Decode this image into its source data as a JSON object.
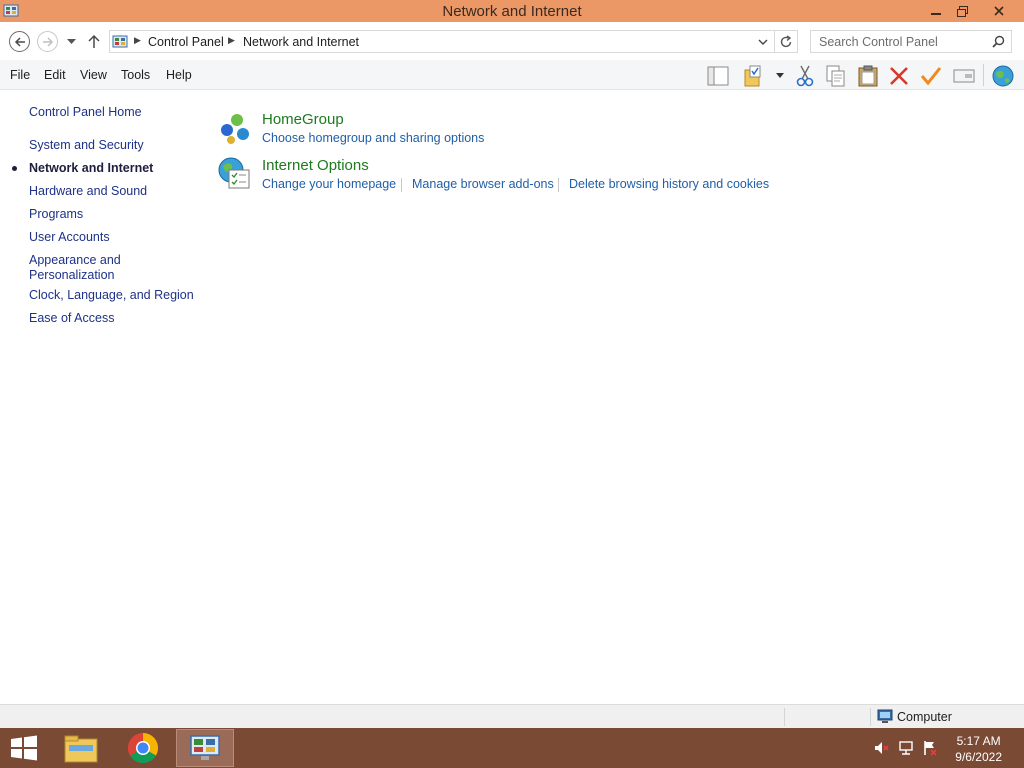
{
  "window": {
    "title": "Network and Internet"
  },
  "address_bar": {
    "breadcrumbs": [
      "Control Panel",
      "Network and Internet"
    ]
  },
  "search": {
    "placeholder": "Search Control Panel"
  },
  "menu": {
    "items": [
      "File",
      "Edit",
      "View",
      "Tools",
      "Help"
    ]
  },
  "toolbar": {
    "icons": [
      "layout-icon",
      "folder-options-icon",
      "cut-icon",
      "copy-icon",
      "paste-icon",
      "delete-icon",
      "checkmark-icon",
      "properties-icon",
      "globe-icon"
    ]
  },
  "sidebar": {
    "home": "Control Panel Home",
    "items": [
      "System and Security",
      "Network and Internet",
      "Hardware and Sound",
      "Programs",
      "User Accounts",
      "Appearance and Personalization",
      "Clock, Language, and Region",
      "Ease of Access"
    ],
    "current_index": 1
  },
  "categories": [
    {
      "title": "HomeGroup",
      "icon": "homegroup-icon",
      "links": [
        "Choose homegroup and sharing options"
      ]
    },
    {
      "title": "Internet Options",
      "icon": "internet-options-icon",
      "links": [
        "Change your homepage",
        "Manage browser add-ons",
        "Delete browsing history and cookies"
      ]
    }
  ],
  "status_bar": {
    "location": "Computer"
  },
  "taskbar": {
    "apps": [
      "file-explorer-icon",
      "chrome-icon",
      "control-panel-icon"
    ],
    "time": "5:17 AM",
    "date": "9/6/2022"
  }
}
